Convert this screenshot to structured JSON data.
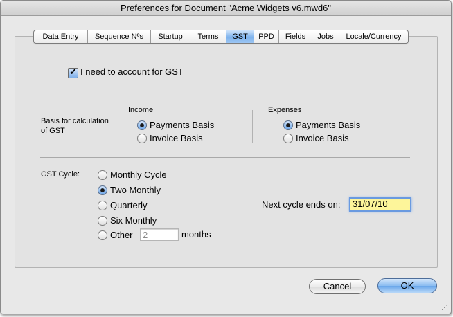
{
  "window": {
    "title": "Preferences for Document \"Acme Widgets v6.mwd6\""
  },
  "tabs": [
    {
      "label": "Data Entry",
      "active": false
    },
    {
      "label": "Sequence Nºs",
      "active": false
    },
    {
      "label": "Startup",
      "active": false
    },
    {
      "label": "Terms",
      "active": false
    },
    {
      "label": "GST",
      "active": true
    },
    {
      "label": "PPD",
      "active": false
    },
    {
      "label": "Fields",
      "active": false
    },
    {
      "label": "Jobs",
      "active": false
    },
    {
      "label": "Locale/Currency",
      "active": false
    }
  ],
  "gst": {
    "account_checkbox": {
      "label": "I need to account for GST",
      "checked": true
    },
    "basis_label": "Basis for calculation of GST",
    "income": {
      "heading": "Income",
      "options": [
        {
          "label": "Payments Basis",
          "selected": true
        },
        {
          "label": "Invoice Basis",
          "selected": false
        }
      ]
    },
    "expenses": {
      "heading": "Expenses",
      "options": [
        {
          "label": "Payments Basis",
          "selected": true
        },
        {
          "label": "Invoice Basis",
          "selected": false
        }
      ]
    },
    "cycle": {
      "label": "GST Cycle:",
      "options": [
        {
          "label": "Monthly Cycle",
          "selected": false
        },
        {
          "label": "Two Monthly",
          "selected": true
        },
        {
          "label": "Quarterly",
          "selected": false
        },
        {
          "label": "Six Monthly",
          "selected": false
        },
        {
          "label": "Other",
          "selected": false
        }
      ],
      "other_months_value": "2",
      "months_label": "months"
    },
    "next_cycle": {
      "label": "Next cycle ends on:",
      "value": "31/07/10"
    }
  },
  "buttons": {
    "cancel": "Cancel",
    "ok": "OK"
  },
  "colors": {
    "accent": "#6aa6ea",
    "focused_field": "#fdf59a"
  }
}
